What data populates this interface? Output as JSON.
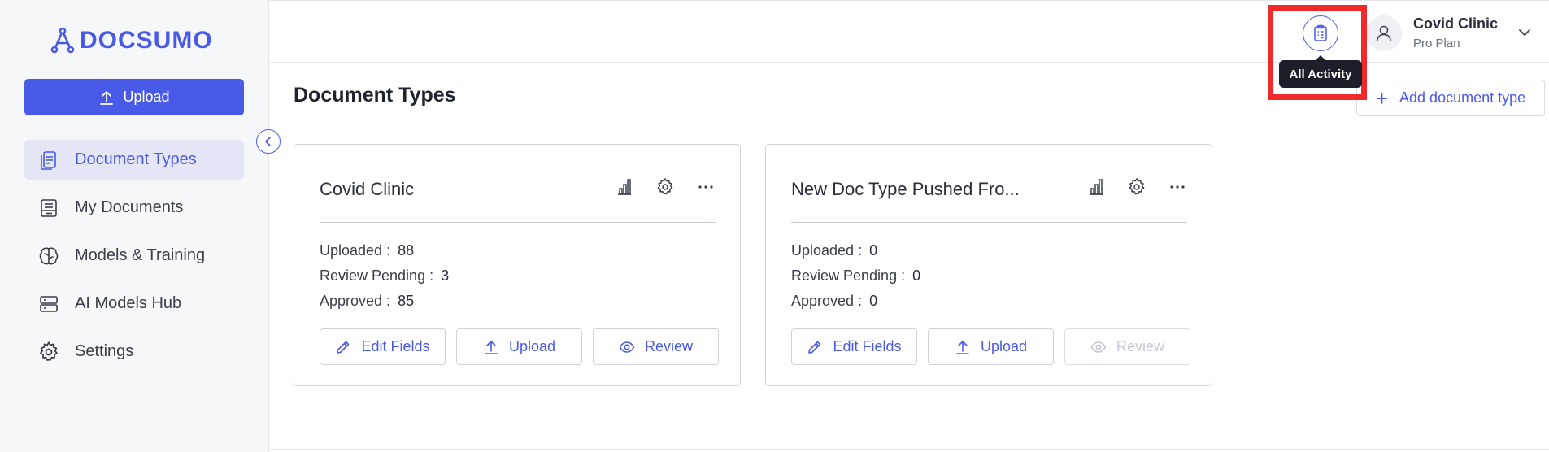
{
  "brand": {
    "logo_text": "DOCSUMO",
    "accent": "#4a5ae8"
  },
  "sidebar": {
    "upload_label": "Upload",
    "items": [
      {
        "label": "Document Types",
        "icon": "document-types-icon",
        "active": true
      },
      {
        "label": "My Documents",
        "icon": "my-documents-icon",
        "active": false
      },
      {
        "label": "Models & Training",
        "icon": "brain-icon",
        "active": false
      },
      {
        "label": "AI Models Hub",
        "icon": "server-icon",
        "active": false
      },
      {
        "label": "Settings",
        "icon": "gear-icon",
        "active": false
      }
    ]
  },
  "header": {
    "activity_tooltip": "All Activity",
    "user": {
      "name": "Covid Clinic",
      "plan": "Pro Plan"
    }
  },
  "main": {
    "title": "Document Types",
    "add_button_label": "Add document type",
    "cards": [
      {
        "title": "Covid Clinic",
        "stats": [
          {
            "label": "Uploaded :",
            "value": "88"
          },
          {
            "label": "Review Pending :",
            "value": "3"
          },
          {
            "label": "Approved :",
            "value": "85"
          }
        ],
        "actions": {
          "edit": "Edit Fields",
          "upload": "Upload",
          "review": "Review"
        },
        "review_disabled": false
      },
      {
        "title": "New Doc Type Pushed Fro...",
        "stats": [
          {
            "label": "Uploaded :",
            "value": "0"
          },
          {
            "label": "Review Pending :",
            "value": "0"
          },
          {
            "label": "Approved :",
            "value": "0"
          }
        ],
        "actions": {
          "edit": "Edit Fields",
          "upload": "Upload",
          "review": "Review"
        },
        "review_disabled": true
      }
    ]
  }
}
